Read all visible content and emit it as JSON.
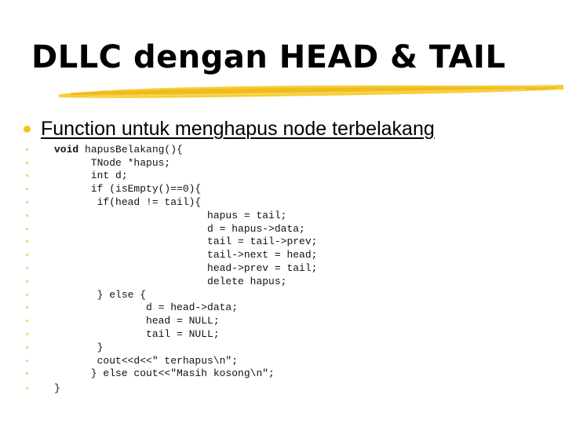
{
  "slide": {
    "title": "DLLC dengan HEAD & TAIL",
    "accent_color": "#f2c418",
    "bullet": "Function untuk menghapus node terbelakang",
    "code_keyword": "void",
    "code_lines": [
      " hapusBelakang(){",
      "      TNode *hapus;",
      "      int d;",
      "      if (isEmpty()==0){",
      "       if(head != tail){",
      "                         hapus = tail;",
      "                         d = hapus->data;",
      "                         tail = tail->prev;",
      "                         tail->next = head;",
      "                         head->prev = tail;",
      "                         delete hapus;",
      "       } else {",
      "               d = head->data;",
      "               head = NULL;",
      "               tail = NULL;",
      "       }",
      "       cout<<d<<\" terhapus\\n\";",
      "      } else cout<<\"Masih kosong\\n\";",
      "}"
    ]
  }
}
